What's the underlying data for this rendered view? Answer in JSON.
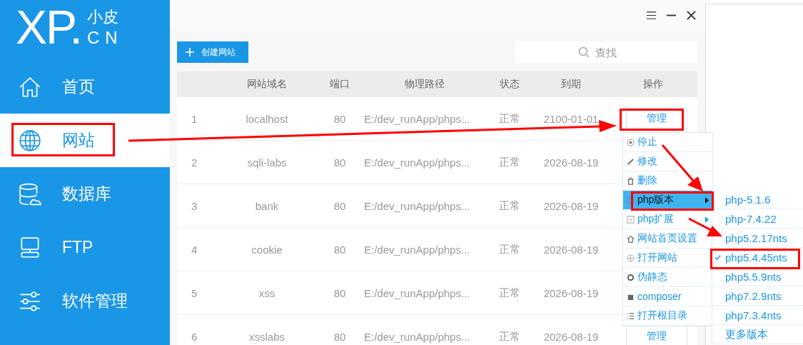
{
  "logo": {
    "main": "XP.",
    "cn": "小皮",
    "suffix": "CN"
  },
  "sidebar": {
    "items": [
      {
        "label": "首页",
        "selected": false
      },
      {
        "label": "网站",
        "selected": true
      },
      {
        "label": "数据库",
        "selected": false
      },
      {
        "label": "FTP",
        "selected": false
      },
      {
        "label": "软件管理",
        "selected": false
      }
    ]
  },
  "toolbar": {
    "create_button": "创建网站",
    "search": {
      "placeholder": "查找"
    }
  },
  "table": {
    "columns": [
      "",
      "网站域名",
      "端口",
      "物理路径",
      "状态",
      "到期",
      "操作"
    ],
    "rows": [
      {
        "index": "1",
        "domain": "localhost",
        "port": "80",
        "path": "E:/dev_runApp/phps...",
        "status": "正常",
        "expiry": "2100-01-01",
        "action": "管理"
      },
      {
        "index": "2",
        "domain": "sqli-labs",
        "port": "80",
        "path": "E:/dev_runApp/phps...",
        "status": "正常",
        "expiry": "2026-08-19"
      },
      {
        "index": "3",
        "domain": "bank",
        "port": "80",
        "path": "E:/dev_runApp/phps...",
        "status": "正常",
        "expiry": "2026-08-19"
      },
      {
        "index": "4",
        "domain": "cookie",
        "port": "80",
        "path": "E:/dev_runApp/phps...",
        "status": "正常",
        "expiry": "2026-08-19"
      },
      {
        "index": "5",
        "domain": "xss",
        "port": "80",
        "path": "E:/dev_runApp/phps...",
        "status": "正常",
        "expiry": "2026-08-19"
      },
      {
        "index": "6",
        "domain": "xsslabs",
        "port": "80",
        "path": "E:/dev_runApp/phps...",
        "status": "正常",
        "expiry": "2026-08-19",
        "action": "管理"
      }
    ]
  },
  "context_menu": {
    "items": [
      {
        "label": "停止",
        "selected": false,
        "submenu": false
      },
      {
        "label": "修改",
        "selected": false,
        "submenu": false
      },
      {
        "label": "删除",
        "selected": false,
        "submenu": false
      },
      {
        "label": "php版本",
        "selected": true,
        "submenu": true
      },
      {
        "label": "php扩展",
        "selected": false,
        "submenu": true
      },
      {
        "label": "网站首页设置",
        "selected": false,
        "submenu": false
      },
      {
        "label": "打开网站",
        "selected": false,
        "submenu": false
      },
      {
        "label": "伪静态",
        "selected": false,
        "submenu": false
      },
      {
        "label": "composer",
        "selected": false,
        "submenu": false
      },
      {
        "label": "打开根目录",
        "selected": false,
        "submenu": false
      }
    ]
  },
  "php_versions": {
    "items": [
      {
        "label": "php-5.1.6",
        "selected": false
      },
      {
        "label": "php-7.4.22",
        "selected": false
      },
      {
        "label": "php5.2.17nts",
        "selected": false
      },
      {
        "label": "php5.4.45nts",
        "selected": true
      },
      {
        "label": "php5.5.9nts",
        "selected": false
      },
      {
        "label": "php7.2.9nts",
        "selected": false
      },
      {
        "label": "php7.3.4nts",
        "selected": false
      },
      {
        "label": "更多版本",
        "selected": false
      }
    ]
  }
}
